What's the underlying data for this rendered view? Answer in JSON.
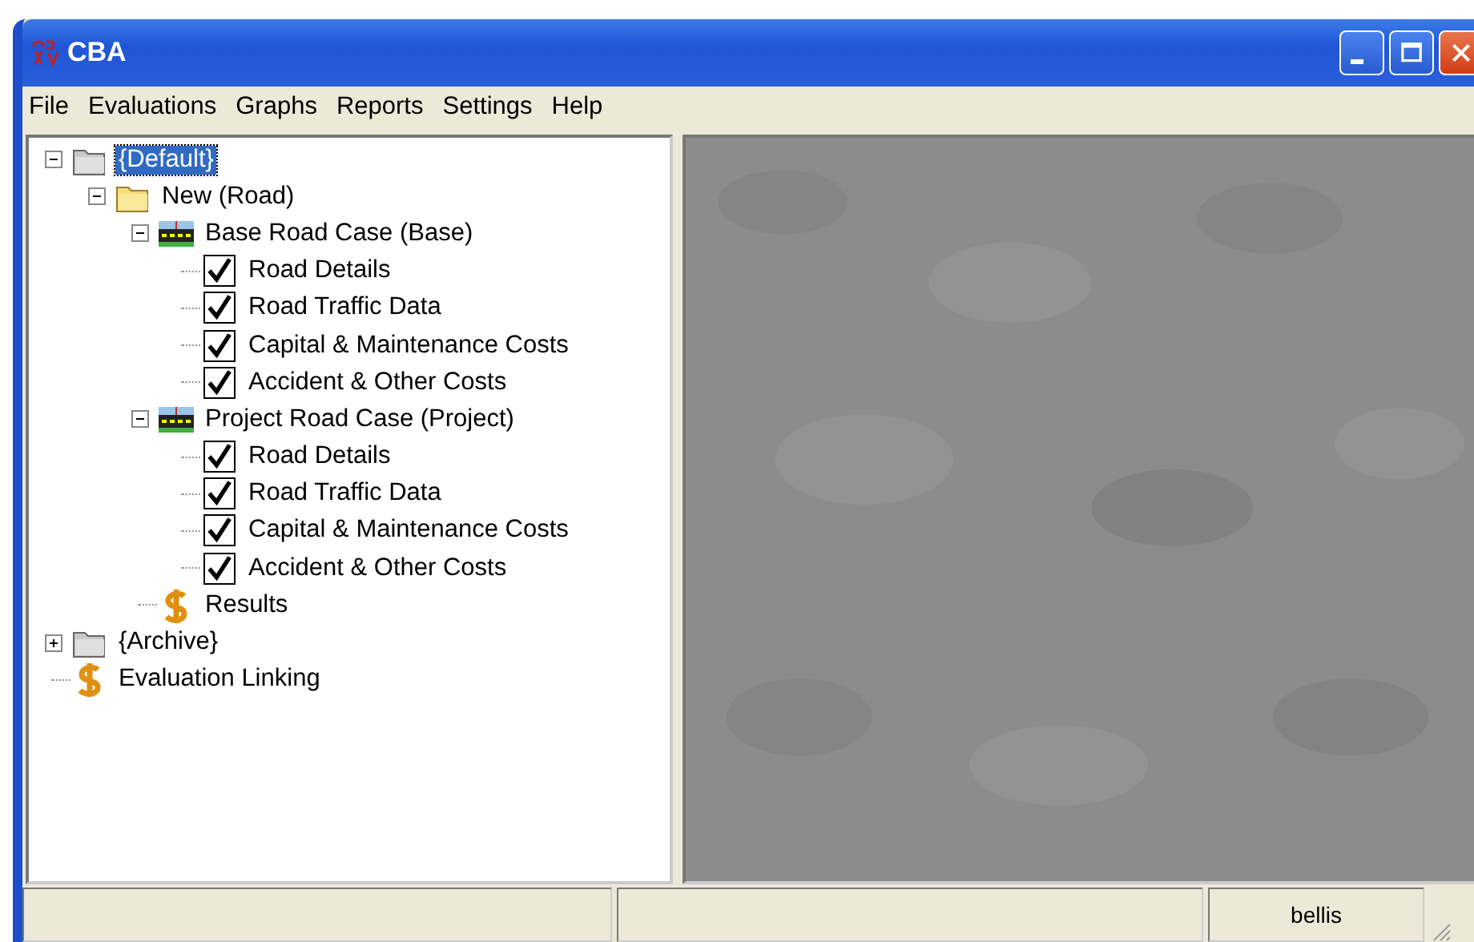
{
  "window": {
    "title": "CBA"
  },
  "menu": [
    "File",
    "Evaluations",
    "Graphs",
    "Reports",
    "Settings",
    "Help"
  ],
  "tree": [
    {
      "label": "{Default}",
      "kind": "folder",
      "expanded": true,
      "selected": true,
      "children": [
        {
          "label": "New (Road)",
          "kind": "folder-open",
          "expanded": true,
          "selected": false,
          "children": [
            {
              "label": "Base Road Case (Base)",
              "kind": "road",
              "expanded": true,
              "selected": false,
              "children": [
                {
                  "label": "Road Details",
                  "kind": "check",
                  "checked": true,
                  "selected": false
                },
                {
                  "label": "Road Traffic Data",
                  "kind": "check",
                  "checked": true,
                  "selected": false
                },
                {
                  "label": "Capital & Maintenance Costs",
                  "kind": "check",
                  "checked": true,
                  "selected": false
                },
                {
                  "label": "Accident & Other Costs",
                  "kind": "check",
                  "checked": true,
                  "selected": false
                }
              ]
            },
            {
              "label": "Project Road Case (Project)",
              "kind": "road",
              "expanded": true,
              "selected": false,
              "children": [
                {
                  "label": "Road Details",
                  "kind": "check",
                  "checked": true,
                  "selected": false
                },
                {
                  "label": "Road Traffic Data",
                  "kind": "check",
                  "checked": true,
                  "selected": false
                },
                {
                  "label": "Capital & Maintenance Costs",
                  "kind": "check",
                  "checked": true,
                  "selected": false
                },
                {
                  "label": "Accident & Other Costs",
                  "kind": "check",
                  "checked": true,
                  "selected": false
                }
              ]
            },
            {
              "label": "Results",
              "kind": "dollar",
              "selected": false
            }
          ]
        }
      ]
    },
    {
      "label": "{Archive}",
      "kind": "folder",
      "expanded": false,
      "selected": false
    },
    {
      "label": "Evaluation Linking",
      "kind": "dollar",
      "selected": false
    }
  ],
  "status_bar": {
    "user": "bellis"
  }
}
